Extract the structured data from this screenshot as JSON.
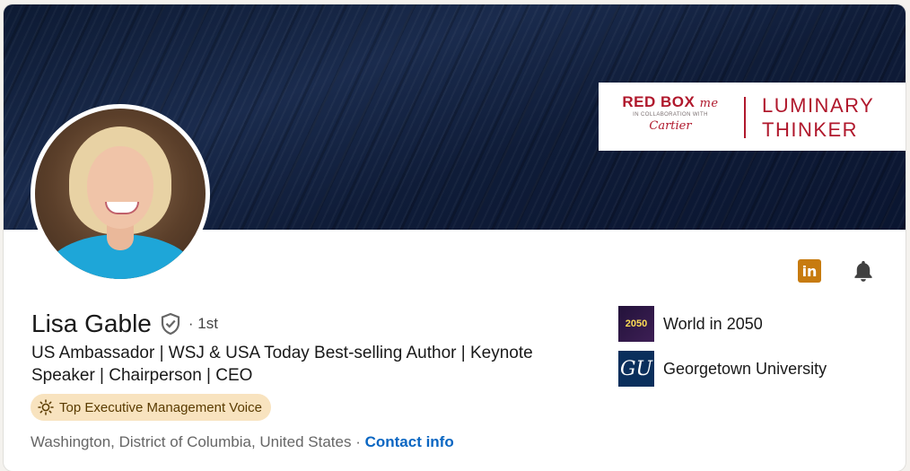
{
  "banner": {
    "brand_left_title": "RED BOX",
    "brand_left_title_suffix": "me",
    "brand_left_collab": "IN COLLABORATION WITH",
    "brand_left_partner": "Cartier",
    "brand_right_line1": "LUMINARY",
    "brand_right_line2": "THINKER"
  },
  "actions": {
    "linkedin_icon_text": "in"
  },
  "profile": {
    "name": "Lisa Gable",
    "degree": "· 1st",
    "headline": "US Ambassador | WSJ & USA Today Best-selling Author | Keynote Speaker | Chairperson | CEO",
    "badge": "Top Executive Management Voice",
    "location": "Washington, District of Columbia, United States",
    "separator": " · ",
    "contact_info": "Contact info"
  },
  "organizations": [
    {
      "name": "World in 2050",
      "logo_text": "2050"
    },
    {
      "name": "Georgetown University",
      "logo_text": "GU"
    }
  ],
  "colors": {
    "link": "#0a66c2",
    "badge_bg": "#f8e3bf",
    "brand_red": "#b0182c",
    "banner_navy": "#1a2b4d"
  }
}
